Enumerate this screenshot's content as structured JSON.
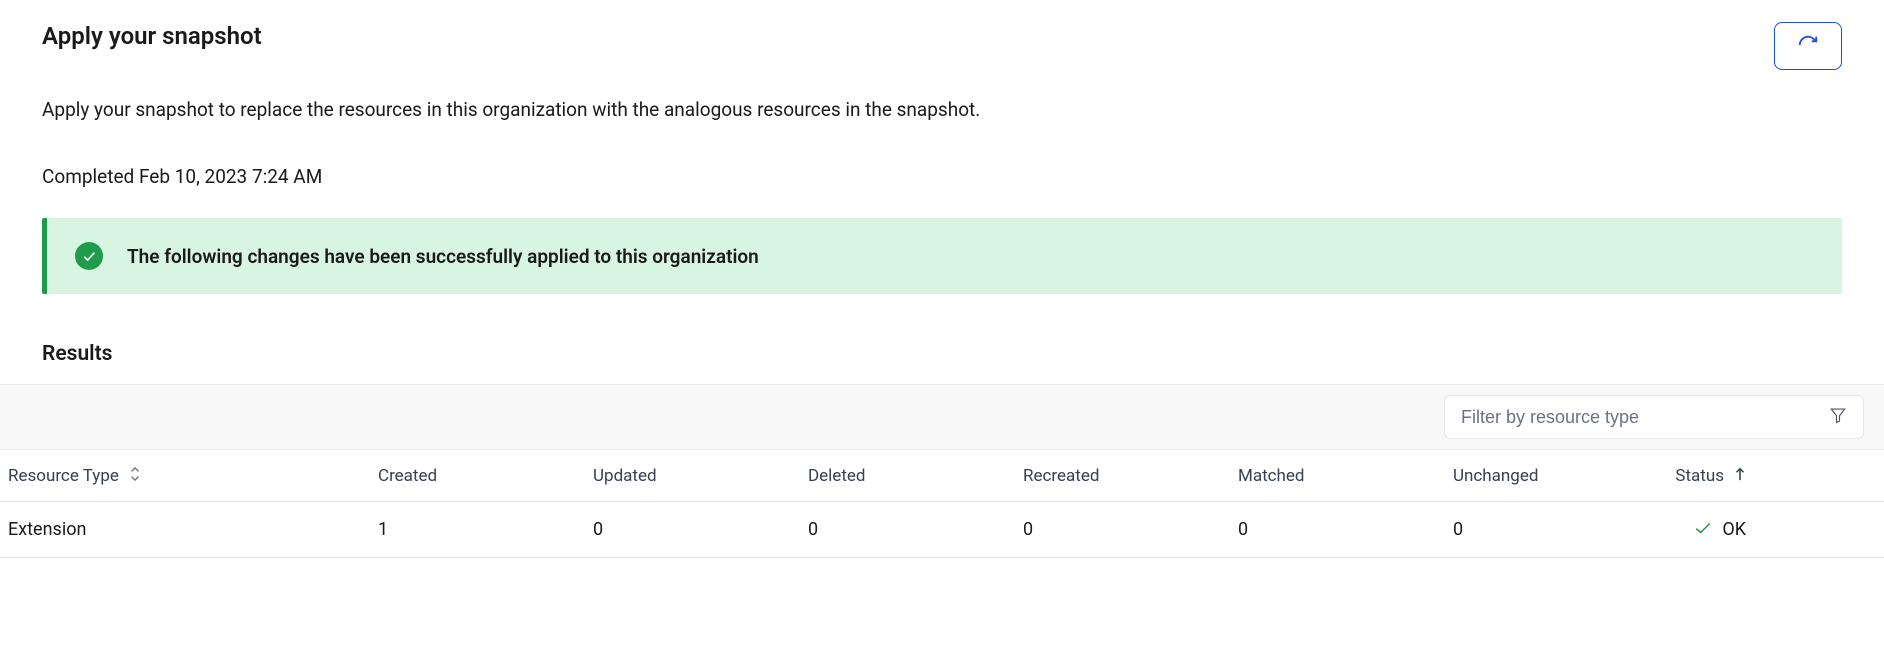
{
  "colors": {
    "accent": "#1e4ed8",
    "success": "#1e9c4c",
    "success_bg": "#d7f5e1"
  },
  "header": {
    "title": "Apply your snapshot",
    "refresh_icon": "refresh-icon"
  },
  "description": "Apply your snapshot to replace the resources in this organization with the analogous resources in the snapshot.",
  "status_line": "Completed Feb 10, 2023 7:24 AM",
  "banner": {
    "icon": "check-circle-icon",
    "message": "The following changes have been successfully applied to this organization"
  },
  "results": {
    "heading": "Results",
    "filter": {
      "placeholder": "Filter by resource type",
      "icon": "filter-icon"
    },
    "columns": {
      "resource_type": "Resource Type",
      "created": "Created",
      "updated": "Updated",
      "deleted": "Deleted",
      "recreated": "Recreated",
      "matched": "Matched",
      "unchanged": "Unchanged",
      "status": "Status"
    },
    "sort": {
      "column": "status",
      "direction": "asc"
    },
    "rows": [
      {
        "resource_type": "Extension",
        "created": "1",
        "updated": "0",
        "deleted": "0",
        "recreated": "0",
        "matched": "0",
        "unchanged": "0",
        "status": "OK"
      }
    ]
  }
}
